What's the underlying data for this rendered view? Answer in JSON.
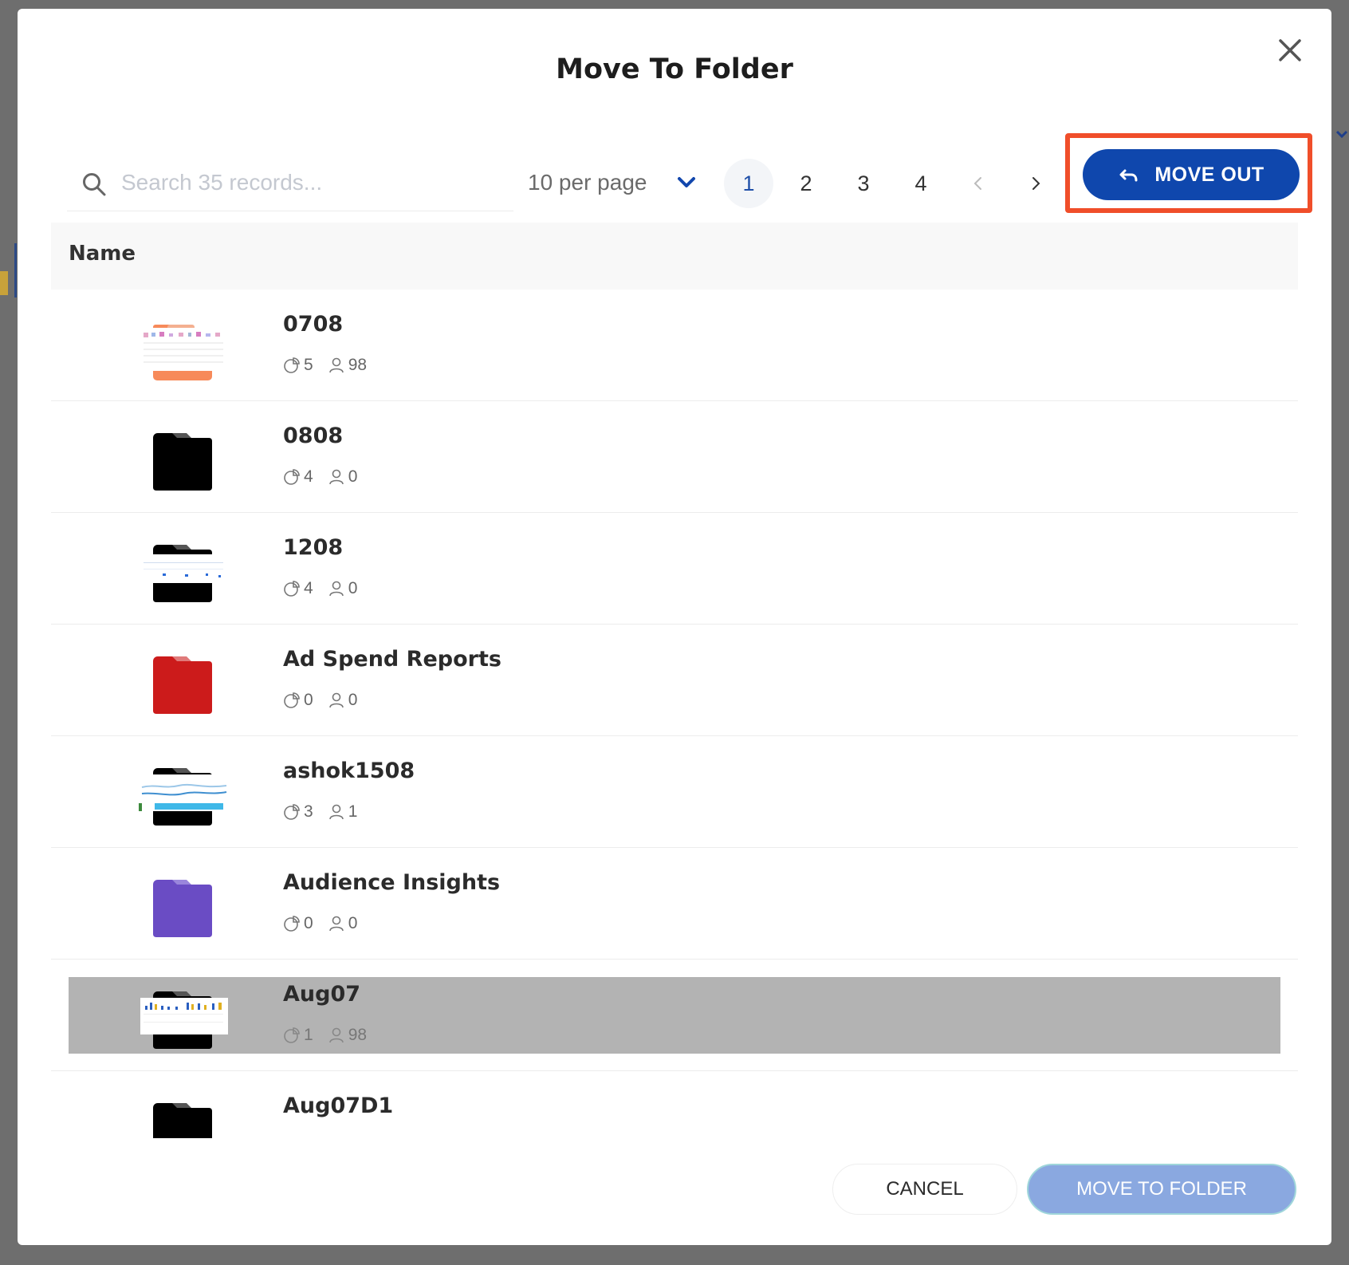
{
  "modal": {
    "title": "Move To Folder"
  },
  "search": {
    "placeholder": "Search 35 records..."
  },
  "pagination": {
    "per_page_label": "10 per page",
    "pages": [
      "1",
      "2",
      "3",
      "4"
    ],
    "active_page": "1"
  },
  "toolbar": {
    "move_out_label": "MOVE OUT"
  },
  "table": {
    "header": "Name",
    "rows": [
      {
        "name": "0708",
        "reports": "5",
        "users": "98",
        "thumb": "preview-orange",
        "color": "#f78a5a"
      },
      {
        "name": "0808",
        "reports": "4",
        "users": "0",
        "thumb": "folder",
        "color": "#000000"
      },
      {
        "name": "1208",
        "reports": "4",
        "users": "0",
        "thumb": "preview-black",
        "color": "#000000"
      },
      {
        "name": "Ad Spend Reports",
        "reports": "0",
        "users": "0",
        "thumb": "folder",
        "color": "#cc1b1b"
      },
      {
        "name": "ashok1508",
        "reports": "3",
        "users": "1",
        "thumb": "preview-blue",
        "color": "#000000"
      },
      {
        "name": "Audience Insights",
        "reports": "0",
        "users": "0",
        "thumb": "folder",
        "color": "#6a4cc4"
      },
      {
        "name": "Aug07",
        "reports": "1",
        "users": "98",
        "thumb": "preview-bars",
        "color": "#000000",
        "selected": true
      },
      {
        "name": "Aug07D1",
        "reports": "",
        "users": "",
        "thumb": "folder",
        "color": "#000000"
      }
    ]
  },
  "footer": {
    "cancel_label": "CANCEL",
    "move_to_folder_label": "MOVE TO FOLDER"
  },
  "colors": {
    "primary": "#0f47ad",
    "highlight": "#f04e2a",
    "disabled_primary": "#8aa8e0"
  }
}
